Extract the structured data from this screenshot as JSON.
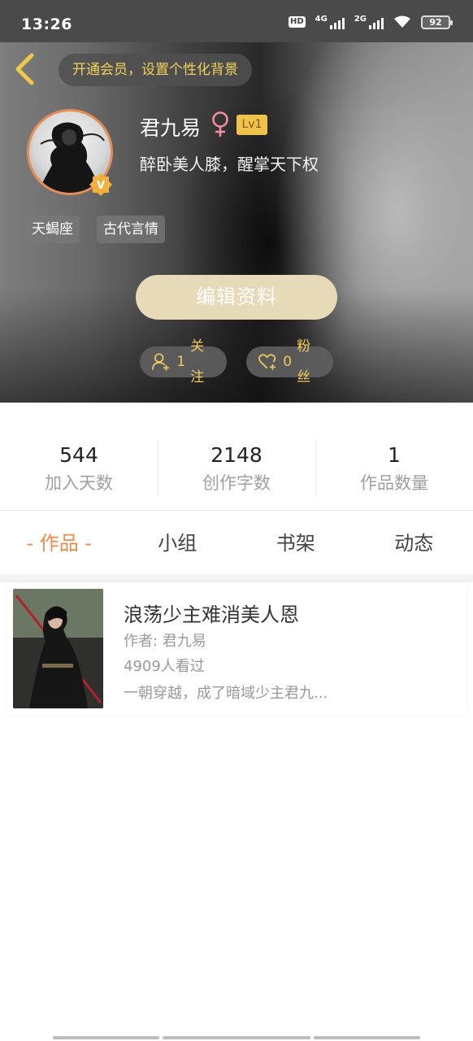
{
  "status_bar": {
    "time": "13:26",
    "hd": "HD",
    "net1": "4G",
    "net2": "2G",
    "battery": "92"
  },
  "header": {
    "vip_prompt": "开通会员，设置个性化背景",
    "nickname": "君九易",
    "level": "Lv1",
    "signature": "醉卧美人膝，醒掌天下权",
    "tags": [
      "天蝎座",
      "古代言情"
    ],
    "edit_button": "编辑资料",
    "follow": {
      "count": "1",
      "label": "关注"
    },
    "fans": {
      "count": "0",
      "label": "粉丝"
    }
  },
  "stats": [
    {
      "value": "544",
      "label": "加入天数"
    },
    {
      "value": "2148",
      "label": "创作字数"
    },
    {
      "value": "1",
      "label": "作品数量"
    }
  ],
  "tabs": [
    {
      "label": "- 作品 -",
      "active": true
    },
    {
      "label": "小组",
      "active": false
    },
    {
      "label": "书架",
      "active": false
    },
    {
      "label": "动态",
      "active": false
    }
  ],
  "works": [
    {
      "title": "浪荡少主难消美人恩",
      "author": "作者: 君九易",
      "views": "4909人看过",
      "description": "一朝穿越，成了暗域少主君九..."
    }
  ],
  "colors": {
    "accent": "#ee8a4a",
    "gold_text": "#f0c95e",
    "edit_button": "#e7dab8",
    "level_badge": "#f0c24a"
  }
}
